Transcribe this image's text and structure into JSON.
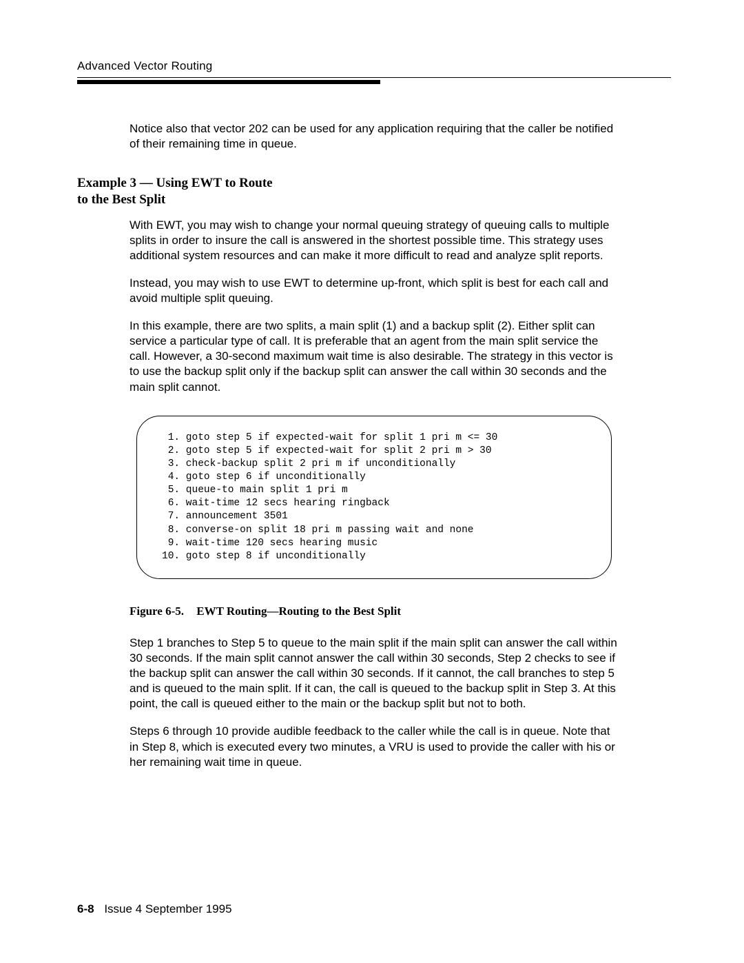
{
  "header": {
    "running_title": "Advanced Vector Routing"
  },
  "intro_para": "Notice also that vector 202 can be used for any application requiring that the caller be notified of their remaining time in queue.",
  "subheading": "Example 3 — Using EWT to Route to the Best Split",
  "para1": "With EWT, you may wish to change your normal queuing strategy of queuing calls to multiple splits in order to insure the call is answered in the shortest possible time. This strategy uses additional system resources and can make it more difficult to read and analyze split reports.",
  "para2": "Instead, you may wish to use EWT to determine up-front, which split is best for each call and avoid multiple split queuing.",
  "para3": "In this example, there are two splits, a main split (1) and a backup split (2). Either split can service a particular type of call. It is preferable that an agent from the main split service the call. However, a 30-second maximum wait time is also desirable. The strategy in this vector is to use the backup split only if the backup split can answer the call within 30 seconds and the main split cannot.",
  "code_block": " 1. goto step 5 if expected-wait for split 1 pri m <= 30\n 2. goto step 5 if expected-wait for split 2 pri m > 30\n 3. check-backup split 2 pri m if unconditionally\n 4. goto step 6 if unconditionally\n 5. queue-to main split 1 pri m\n 6. wait-time 12 secs hearing ringback\n 7. announcement 3501\n 8. converse-on split 18 pri m passing wait and none\n 9. wait-time 120 secs hearing music\n10. goto step 8 if unconditionally",
  "figure": {
    "label": "Figure 6-5.",
    "title": "EWT Routing—Routing to the Best Split"
  },
  "para4": "Step 1 branches to Step 5 to queue to the main split if the main split can answer the call within 30 seconds. If the main split cannot answer the call within 30 seconds, Step 2 checks to see if the backup split can answer the call within 30 seconds. If it cannot, the call branches to step 5 and is queued to the main split. If it can, the call is queued to the backup split in Step 3. At this point, the call is queued either to the main or the backup split but not to both.",
  "para5": "Steps 6 through 10 provide audible feedback to the caller while the call is in queue. Note that in Step 8, which is executed every two minutes, a VRU is used to provide the caller with his or her remaining wait time in queue.",
  "footer": {
    "page_number": "6-8",
    "issue_text": "Issue  4 September 1995"
  }
}
